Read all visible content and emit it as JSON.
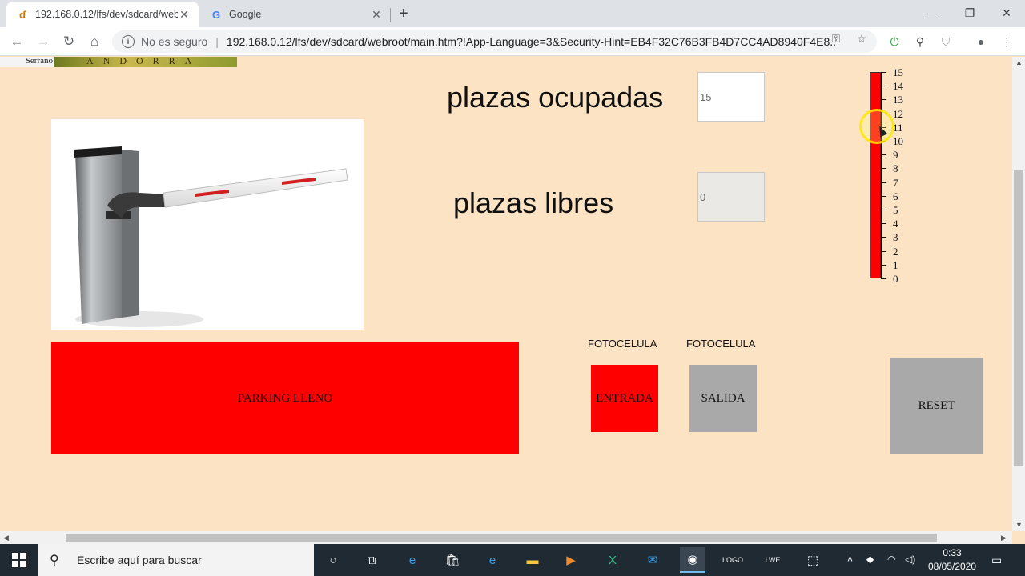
{
  "browser": {
    "tabs": [
      {
        "title": "192.168.0.12/lfs/dev/sdcard/web",
        "active": true
      },
      {
        "title": "Google",
        "active": false
      }
    ],
    "security_label": "No es seguro",
    "url": "192.168.0.12/lfs/dev/sdcard/webroot/main.htm?!App-Language=3&Security-Hint=EB4F32C76B3FB4D7CC4AD8940F4E8..."
  },
  "page": {
    "logo": {
      "left_text": "Serrano",
      "right_text": "ANDORRA"
    },
    "occupied": {
      "label": "plazas ocupadas",
      "value": "15"
    },
    "free": {
      "label": "plazas libres",
      "value": "0"
    },
    "gauge": {
      "min": 0,
      "max": 15,
      "value": 15,
      "ticks": [
        "15",
        "14",
        "13",
        "12",
        "11",
        "10",
        "9",
        "8",
        "7",
        "6",
        "5",
        "4",
        "3",
        "2",
        "1",
        "0"
      ],
      "fill_color": "#ff0000"
    },
    "status_block": {
      "text": "PARKING LLENO",
      "color": "#ff0000"
    },
    "entry": {
      "caption": "FOTOCELULA",
      "text": "ENTRADA",
      "color": "#ff0000"
    },
    "exit": {
      "caption": "FOTOCELULA",
      "text": "SALIDA",
      "color": "#a9a9a9"
    },
    "reset": {
      "text": "RESET",
      "color": "#a9a9a9"
    }
  },
  "taskbar": {
    "search_placeholder": "Escribe aquí para buscar",
    "time": "0:33",
    "date": "08/05/2020"
  }
}
